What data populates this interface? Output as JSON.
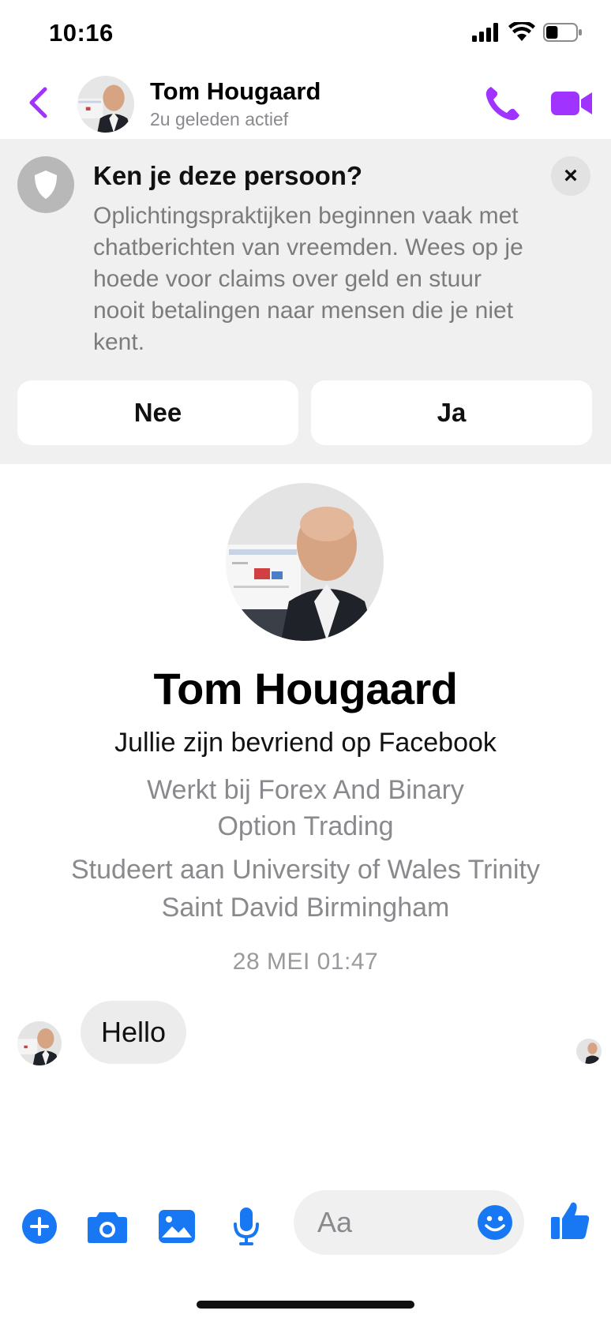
{
  "status_bar": {
    "time": "10:16",
    "icons": [
      "signal-icon",
      "wifi-icon",
      "battery-icon"
    ],
    "battery_level": 0.4
  },
  "header": {
    "name": "Tom Hougaard",
    "status": "2u geleden actief",
    "icons": [
      "back-chevron-icon",
      "phone-icon",
      "video-camera-icon"
    ],
    "accent_color": "#a033ff"
  },
  "banner": {
    "title": "Ken je deze persoon?",
    "text": "Oplichtingspraktijken beginnen vaak met chatberichten van vreemden. Wees op je hoede voor claims over geld en stuur nooit betalingen naar mensen die je niet kent.",
    "close_symbol": "×",
    "button_no": "Nee",
    "button_yes": "Ja"
  },
  "profile": {
    "name": "Tom Hougaard",
    "friends": "Jullie zijn bevriend op Facebook",
    "work": "Werkt bij Forex And Binary Option Trading",
    "study": "Studeert aan University of Wales Trinity Saint David Birmingham"
  },
  "conversation": {
    "timestamp": "28 MEI 01:47",
    "messages": [
      {
        "text": "Hello",
        "from": "Tom Hougaard"
      }
    ]
  },
  "composer": {
    "placeholder": "Aa",
    "icons": [
      "plus-circle-icon",
      "camera-icon",
      "image-icon",
      "microphone-icon",
      "emoji-icon",
      "thumbs-up-icon"
    ],
    "icon_color": "#1877f2"
  }
}
